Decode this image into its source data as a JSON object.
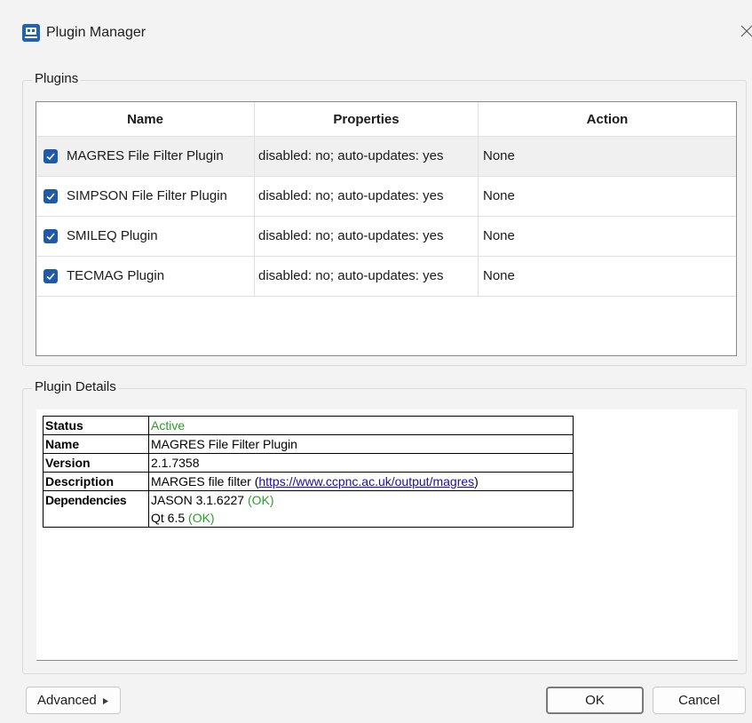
{
  "window": {
    "title": "Plugin Manager",
    "icon": "app-icon",
    "close_icon": "close-icon"
  },
  "plugins_group": {
    "label": "Plugins",
    "columns": [
      "Name",
      "Properties",
      "Action"
    ],
    "rows": [
      {
        "name": "MAGRES File Filter Plugin",
        "properties": "disabled: no; auto-updates: yes",
        "action": "None",
        "checked": true,
        "selected": true
      },
      {
        "name": "SIMPSON File Filter Plugin",
        "properties": "disabled: no; auto-updates: yes",
        "action": "None",
        "checked": true,
        "selected": false
      },
      {
        "name": "SMILEQ Plugin",
        "properties": "disabled: no; auto-updates: yes",
        "action": "None",
        "checked": true,
        "selected": false
      },
      {
        "name": "TECMAG Plugin",
        "properties": "disabled: no; auto-updates: yes",
        "action": "None",
        "checked": true,
        "selected": false
      }
    ]
  },
  "details_group": {
    "label": "Plugin Details",
    "status_label": "Status",
    "status_value": "Active",
    "name_label": "Name",
    "name_value": "MAGRES File Filter Plugin",
    "version_label": "Version",
    "version_value": "2.1.7358",
    "description_label": "Description",
    "description_prefix": "MARGES file filter (",
    "description_link": "https://www.ccpnc.ac.uk/output/magres",
    "description_suffix": ")",
    "dependencies_label": "Dependencies",
    "dependencies": [
      {
        "name": "JASON 3.1.6227",
        "status": "(OK)"
      },
      {
        "name": "Qt 6.5",
        "status": "(OK)"
      }
    ]
  },
  "buttons": {
    "advanced": "Advanced",
    "advanced_icon": "triangle-right-icon",
    "ok": "OK",
    "cancel": "Cancel"
  },
  "colors": {
    "accent": "#1f5aa8",
    "status_ok": "#2a9d2a",
    "link": "#1a0dab"
  }
}
